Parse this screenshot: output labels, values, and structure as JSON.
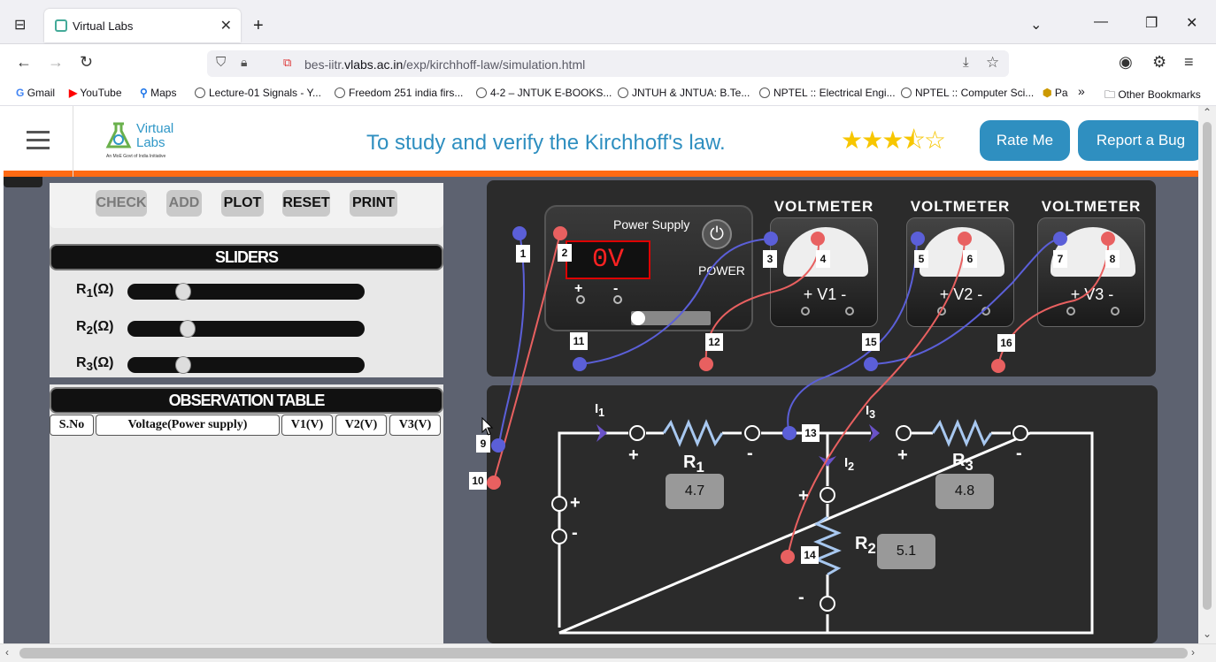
{
  "browser": {
    "tab_title": "Virtual Labs",
    "url_prefix": "bes-iitr.",
    "url_domain": "vlabs.ac.in",
    "url_path": "/exp/kirchhoff-law/simulation.html",
    "bookmarks": [
      "Gmail",
      "YouTube",
      "Maps",
      "Lecture-01 Signals - Y...",
      "Freedom 251 india firs...",
      "4-2 – JNTUK E-BOOKS...",
      "JNTUH & JNTUA: B.Te...",
      "NPTEL :: Electrical Engi...",
      "NPTEL :: Computer Sci...",
      "Pa"
    ],
    "other_bookmarks": "Other Bookmarks"
  },
  "header": {
    "logo_text_line1": "Virtual",
    "logo_text_line2": "Labs",
    "logo_sub": "An MoE Govt of India Initiative",
    "title": "To study and verify the Kirchhoff's law.",
    "stars": "★★★⯪☆",
    "rate_label": "Rate Me",
    "bug_label": "Report a Bug"
  },
  "controls": {
    "check": "CHECK",
    "add": "ADD",
    "plot": "PLOT",
    "reset": "RESET",
    "print": "PRINT"
  },
  "sliders": {
    "title": "SLIDERS",
    "r1": "Ω",
    "r2": "Ω",
    "r3": "Ω",
    "r1_level": 0.2,
    "r2_level": 0.22,
    "r3_level": 0.2
  },
  "observation": {
    "title": "OBSERVATION TABLE",
    "columns": [
      "S.No",
      "Voltage(Power supply)",
      "V1(V)",
      "V2(V)",
      "V3(V)"
    ]
  },
  "power_supply": {
    "title": "Power Supply",
    "display": "0V",
    "power_label": "POWER"
  },
  "voltmeters": [
    {
      "title": "VOLTMETER",
      "name": "V1"
    },
    {
      "title": "VOLTMETER",
      "name": "V2"
    },
    {
      "title": "VOLTMETER",
      "name": "V3"
    }
  ],
  "terminals": [
    "1",
    "2",
    "3",
    "4",
    "5",
    "6",
    "7",
    "8",
    "9",
    "10",
    "11",
    "12",
    "13",
    "14",
    "15",
    "16"
  ],
  "circuit": {
    "r1_value": "4.7",
    "r2_value": "5.1",
    "r3_value": "4.8"
  },
  "colors": {
    "accent": "#2f8fc0",
    "header_stripe": "#ff6a13",
    "wire_blue": "#5b5fd8",
    "wire_red": "#e86060",
    "resistor": "#a8c8f0"
  }
}
